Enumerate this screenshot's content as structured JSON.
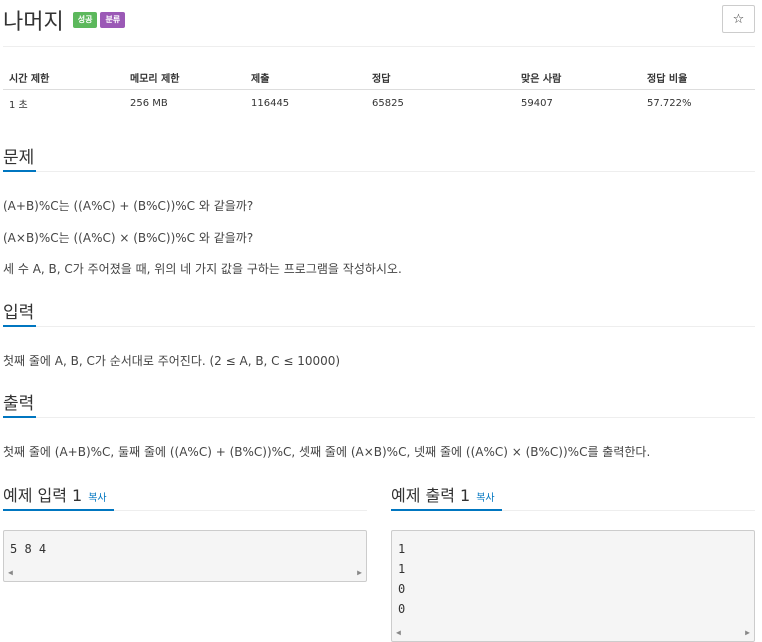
{
  "problem": {
    "title": "나머지",
    "badges": [
      {
        "label": "성공",
        "color": "#5cb85c"
      },
      {
        "label": "분류",
        "color": "#9b59b6"
      }
    ],
    "star_icon": "☆"
  },
  "info_table": {
    "headers": [
      "시간 제한",
      "메모리 제한",
      "제출",
      "정답",
      "맞은 사람",
      "정답 비율"
    ],
    "values": [
      "1 초",
      "256 MB",
      "116445",
      "65825",
      "59407",
      "57.722%"
    ]
  },
  "sections": {
    "problem": {
      "title": "문제",
      "lines": [
        "(A+B)%C는 ((A%C) + (B%C))%C 와 같을까?",
        "(A×B)%C는 ((A%C) × (B%C))%C 와 같을까?",
        "세 수 A, B, C가 주어졌을 때, 위의 네 가지 값을 구하는 프로그램을 작성하시오."
      ]
    },
    "input": {
      "title": "입력",
      "lines": [
        "첫째 줄에 A, B, C가 순서대로 주어진다. (2 ≤ A, B, C ≤ 10000)"
      ]
    },
    "output": {
      "title": "출력",
      "lines": [
        "첫째 줄에 (A+B)%C, 둘째 줄에 ((A%C) + (B%C))%C, 셋째 줄에 (A×B)%C, 넷째 줄에 ((A%C) × (B%C))%C를 출력한다."
      ]
    }
  },
  "samples": {
    "input": {
      "title": "예제 입력 1",
      "copy": "복사",
      "lines": [
        "5 8 4"
      ]
    },
    "output": {
      "title": "예제 출력 1",
      "copy": "복사",
      "lines": [
        "1",
        "1",
        "0",
        "0"
      ]
    }
  },
  "colors": {
    "accent": "#0076c0"
  }
}
